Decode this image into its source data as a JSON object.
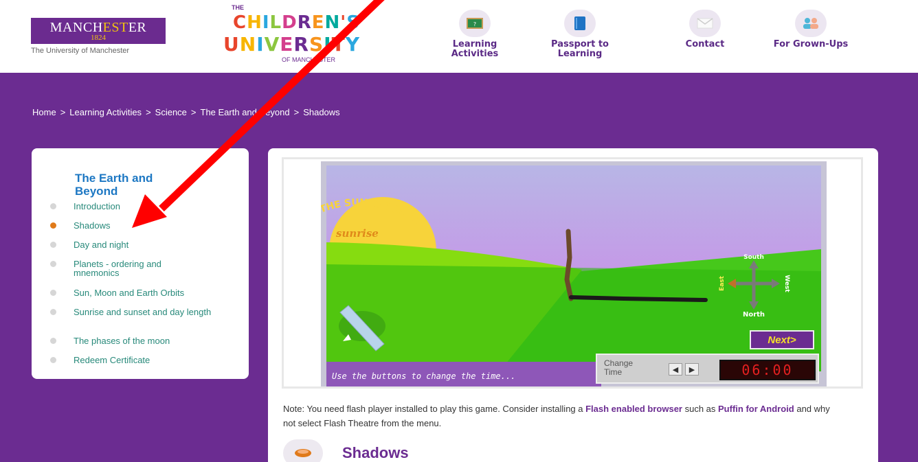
{
  "header": {
    "uom_logo": {
      "name_part1": "MANCH",
      "name_accent": "EST",
      "name_part2": "ER",
      "year": "1824",
      "subtitle": "The University of Manchester"
    },
    "cu_logo": {
      "the": "THE",
      "word1": "CHILDREN'S",
      "word2": "UNIVERSITY",
      "of": "OF MANCHESTER"
    },
    "nav": [
      {
        "label": "Learning Activities",
        "icon": "blackboard-icon"
      },
      {
        "label": "Passport to Learning",
        "icon": "book-icon"
      },
      {
        "label": "Contact",
        "icon": "envelope-icon"
      },
      {
        "label": "For Grown-Ups",
        "icon": "people-icon"
      }
    ]
  },
  "breadcrumb": [
    "Home",
    "Learning Activities",
    "Science",
    "The Earth and Beyond",
    "Shadows"
  ],
  "breadcrumb_sep": ">",
  "sidebar": {
    "title": "The Earth and Beyond",
    "items": [
      {
        "label": "Introduction",
        "active": false
      },
      {
        "label": "Shadows",
        "active": true
      },
      {
        "label": "Day and night",
        "active": false
      },
      {
        "label": "Planets - ordering and mnemonics",
        "active": false
      },
      {
        "label": "Sun, Moon and Earth Orbits",
        "active": false
      },
      {
        "label": "Sunrise and sunset and day length",
        "active": false
      },
      {
        "label": "The phases of the moon",
        "active": false
      },
      {
        "label": "Redeem Certificate",
        "active": false
      }
    ]
  },
  "game": {
    "sun_arc_text": "THE SUN IS TOO TI",
    "sun_label": "sunrise",
    "compass": {
      "north": "North",
      "south": "South",
      "east": "East",
      "west": "West"
    },
    "next_label": "Next>",
    "hint": "Use the buttons to change the time...",
    "change_time_label": "Change Time",
    "prev_symbol": "◀",
    "next_symbol": "▶",
    "time": "06:00"
  },
  "note": {
    "text1": "Note: You need flash player installed to play this game.  Consider installing a ",
    "link1": "Flash enabled browser",
    "text2": " such as ",
    "link2": "Puffin for Android",
    "text3": " and why not select Flash Theatre from the menu."
  },
  "section_title": "Shadows",
  "colors": {
    "purple": "#6b2c91",
    "sidebar_link": "#27897a",
    "sidebar_title": "#1c77c3",
    "active_dot": "#e07a1a",
    "annotation_arrow": "#ff0000"
  }
}
